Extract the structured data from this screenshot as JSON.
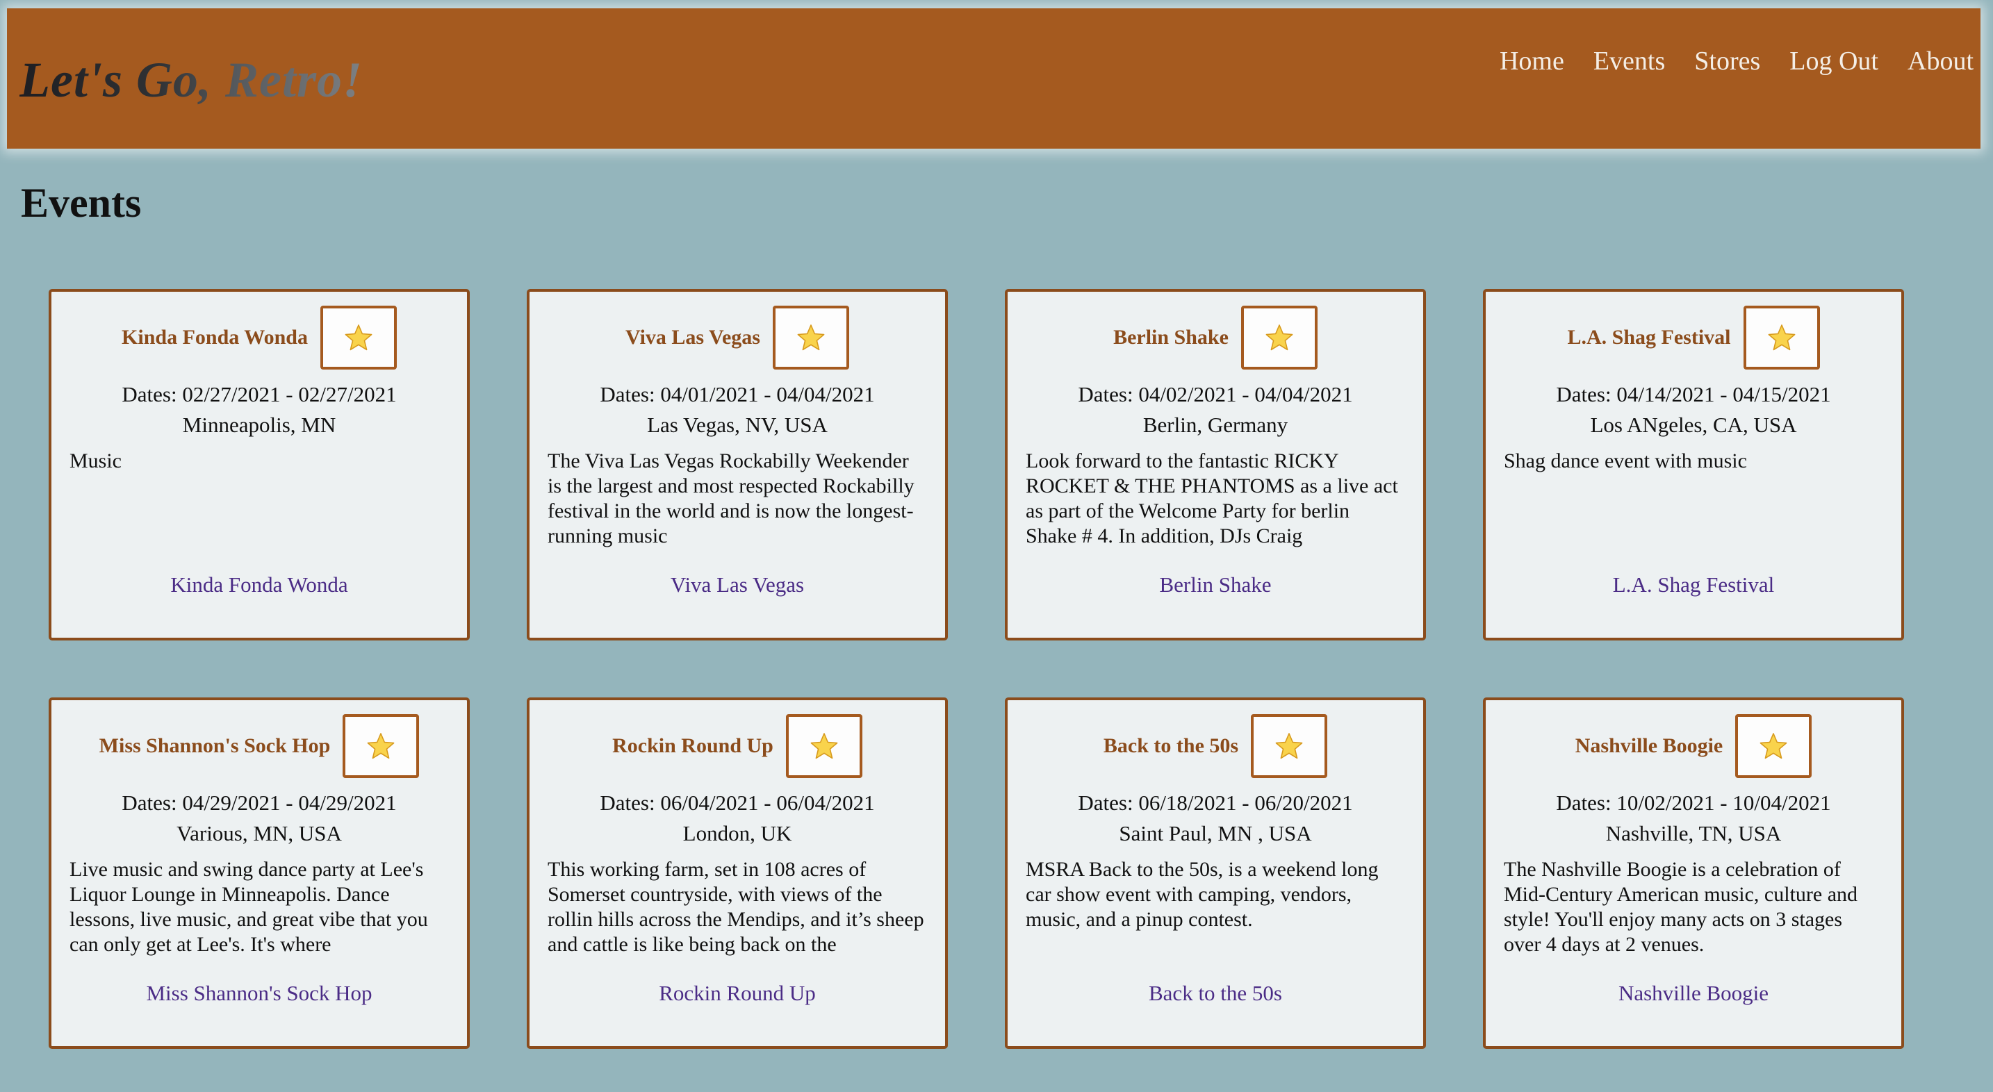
{
  "site": {
    "brand": "Let's Go, Retro!"
  },
  "nav": {
    "items": [
      "Home",
      "Events",
      "Stores",
      "Log Out",
      "About"
    ]
  },
  "page": {
    "title": "Events"
  },
  "events": [
    {
      "title": "Kinda Fonda Wonda",
      "dates": "Dates: 02/27/2021 - 02/27/2021",
      "location": "Minneapolis, MN",
      "description": "Music",
      "link": "Kinda Fonda Wonda"
    },
    {
      "title": "Viva Las Vegas",
      "dates": "Dates: 04/01/2021 - 04/04/2021",
      "location": "Las Vegas, NV, USA",
      "description": "The Viva Las Vegas Rockabilly Weekender is the largest and most respected Rockabilly festival in the world and is now the longest-running music",
      "link": "Viva Las Vegas"
    },
    {
      "title": "Berlin Shake",
      "dates": "Dates: 04/02/2021 - 04/04/2021",
      "location": "Berlin, Germany",
      "description": "Look forward to the fantastic RICKY ROCKET & THE PHANTOMS as a live act as part of the Welcome Party for berlin Shake # 4. In addition, DJs Craig",
      "link": "Berlin Shake"
    },
    {
      "title": "L.A. Shag Festival",
      "dates": "Dates: 04/14/2021 - 04/15/2021",
      "location": "Los ANgeles, CA, USA",
      "description": "Shag dance event with music",
      "link": "L.A. Shag Festival"
    },
    {
      "title": "Miss Shannon's Sock Hop",
      "dates": "Dates: 04/29/2021 - 04/29/2021",
      "location": "Various, MN, USA",
      "description": "Live music and swing dance party at Lee's Liquor Lounge in Minneapolis. Dance lessons, live music, and great vibe that you can only get at Lee's. It's where",
      "link": "Miss Shannon's Sock Hop"
    },
    {
      "title": "Rockin Round Up",
      "dates": "Dates: 06/04/2021 - 06/04/2021",
      "location": "London, UK",
      "description": "This working farm, set in 108 acres of Somerset countryside, with views of the rollin hills across the Mendips, and it’s sheep and cattle is like being back on the",
      "link": "Rockin Round Up"
    },
    {
      "title": "Back to the 50s",
      "dates": "Dates: 06/18/2021 - 06/20/2021",
      "location": "Saint Paul, MN , USA",
      "description": "MSRA Back to the 50s, is a weekend long car show event with camping, vendors, music, and a pinup contest.",
      "link": "Back to the 50s"
    },
    {
      "title": "Nashville Boogie",
      "dates": "Dates: 10/02/2021 - 10/04/2021",
      "location": "Nashville, TN, USA",
      "description": "The Nashville Boogie is a celebration of Mid-Century American music, culture and style! You'll enjoy many acts on 3 stages over 4 days at 2 venues.",
      "link": "Nashville Boogie"
    }
  ],
  "icons": {
    "favorite": "star-icon"
  },
  "colors": {
    "header": "#a55a1f",
    "background": "#94b5bc",
    "card": "#edf1f2",
    "accent": "#8b4c1c",
    "link": "#4b2c86"
  }
}
